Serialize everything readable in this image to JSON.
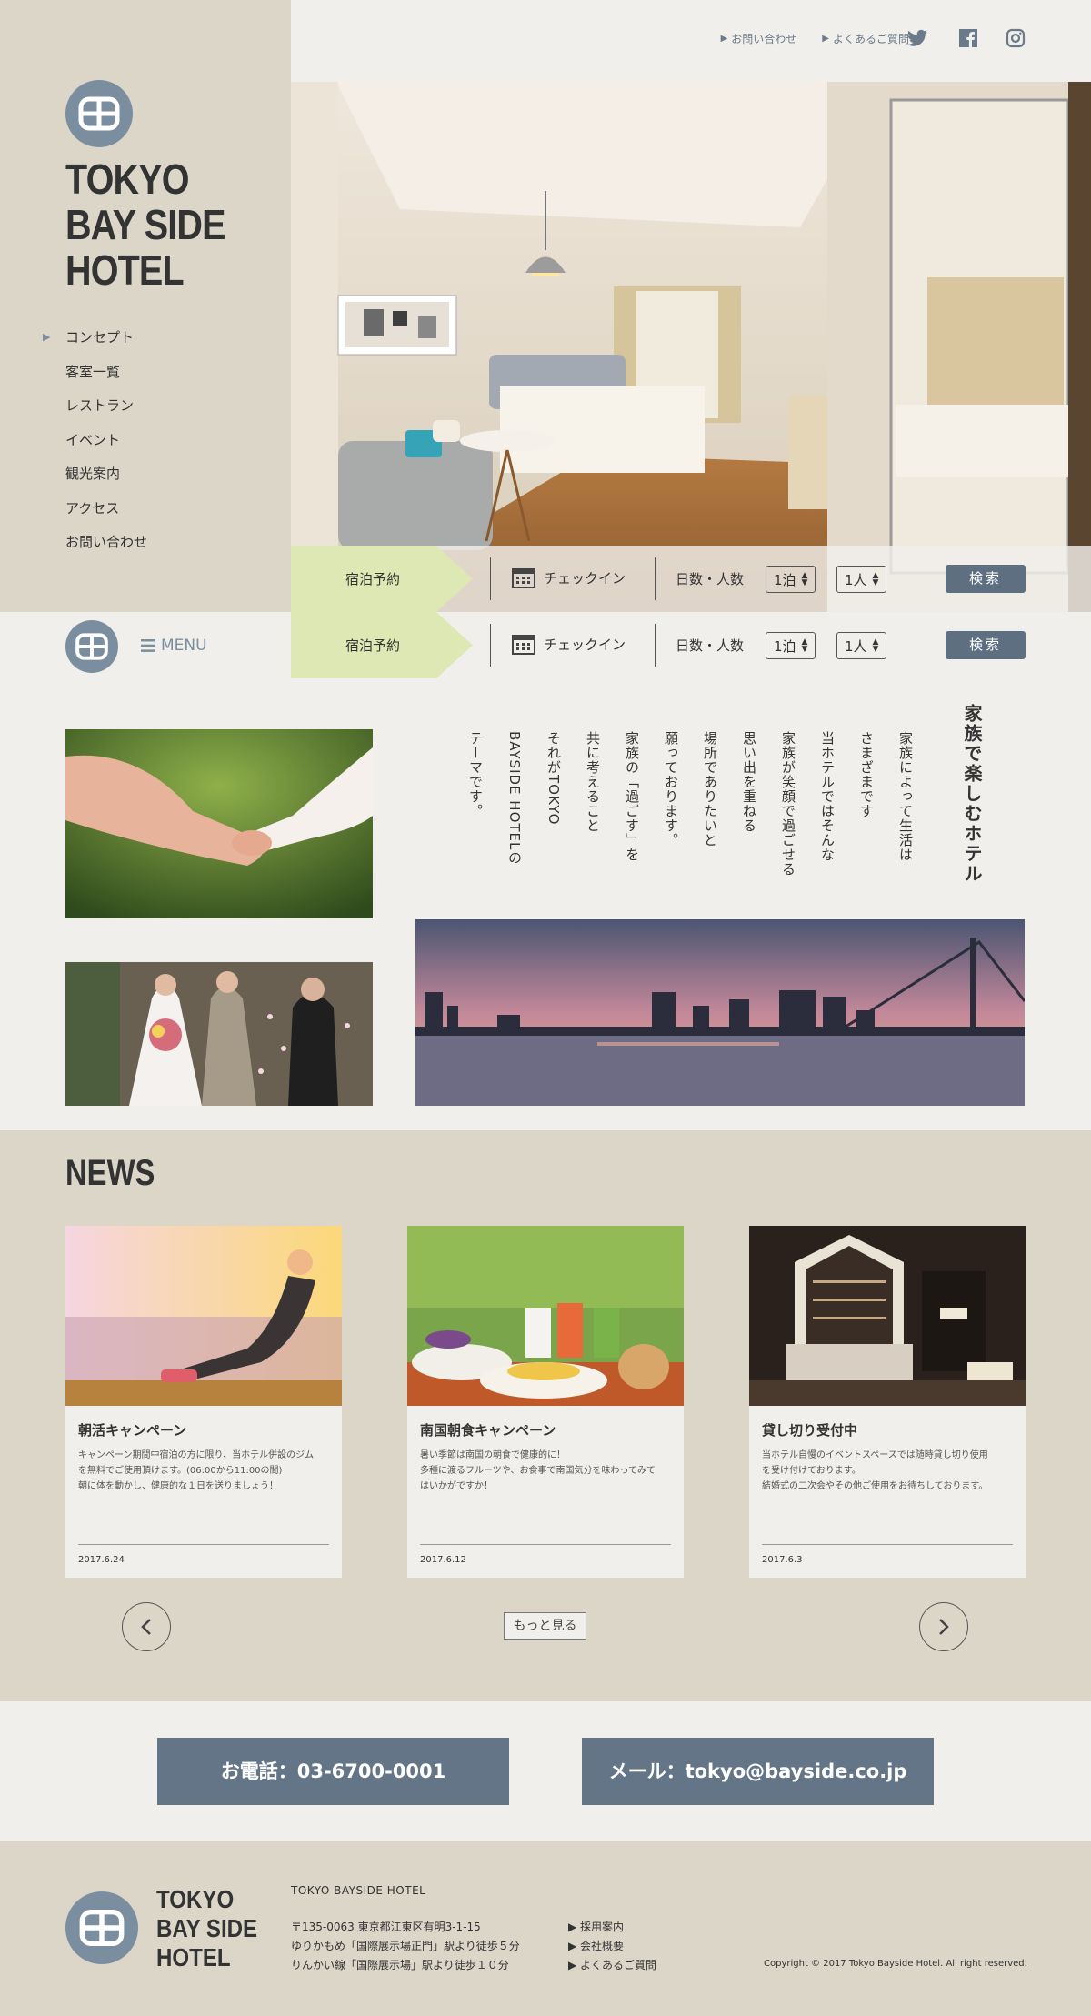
{
  "header": {
    "links": [
      {
        "label": "お問い合わせ"
      },
      {
        "label": "よくあるご質問"
      }
    ],
    "socials": [
      "twitter-icon",
      "facebook-icon",
      "instagram-icon"
    ]
  },
  "sidebar": {
    "brand_lines": [
      "TOKYO",
      "BAY SIDE",
      "HOTEL"
    ],
    "nav": [
      {
        "label": "コンセプト",
        "active": true
      },
      {
        "label": "客室一覧"
      },
      {
        "label": "レストラン"
      },
      {
        "label": "イベント"
      },
      {
        "label": "観光案内"
      },
      {
        "label": "アクセス"
      },
      {
        "label": "お問い合わせ"
      }
    ]
  },
  "reservation": {
    "label": "宿泊予約",
    "checkin": "チェックイン",
    "people_label": "日数・人数",
    "nights": "1泊",
    "guests": "1人",
    "search": "検索"
  },
  "menu": {
    "label": "MENU"
  },
  "concept": {
    "title": "家族で楽しむホテル",
    "lines": [
      "家族によって生活は",
      "さまざまです",
      "当ホテルではそんな",
      "家族が笑顔で過ごせる",
      "思い出を重ねる",
      "場所でありたいと",
      "願っております。",
      "家族の「過ごす」を",
      "共に考えること",
      "それがTOKYO",
      "BAYSIDE HOTELの",
      "テーマです。"
    ]
  },
  "news": {
    "title": "NEWS",
    "items": [
      {
        "title": "朝活キャンペーン",
        "body": [
          "キャンペーン期間中宿泊の方に限り、当ホテル併設のジム",
          "を無料でご使用頂けます。(06:00から11:00の間)",
          "朝に体を動かし、健康的な１日を送りましょう！"
        ],
        "date": "2017.6.24"
      },
      {
        "title": "南国朝食キャンペーン",
        "body": [
          "暑い季節は南国の朝食で健康的に！",
          "多種に渡るフルーツや、お食事で南国気分を味わってみて",
          "はいかがですか！"
        ],
        "date": "2017.6.12"
      },
      {
        "title": "貸し切り受付中",
        "body": [
          "当ホテル自慢のイベントスペースでは随時貸し切り使用",
          "を受け付けております。",
          "結婚式の二次会やその他ご使用をお待ちしております。"
        ],
        "date": "2017.6.3"
      }
    ],
    "more": "もっと見る"
  },
  "contact": {
    "phone": "お電話：03-6700-0001",
    "mail": "メール：tokyo@bayside.co.jp"
  },
  "footer": {
    "brand_lines": [
      "TOKYO",
      "BAY SIDE",
      "HOTEL"
    ],
    "name": "TOKYO BAYSIDE HOTEL",
    "address": [
      "〒135-0063 東京都江東区有明3-1-15",
      "ゆりかもめ「国際展示場正門」駅より徒歩５分",
      "りんかい線「国際展示場」駅より徒歩１０分"
    ],
    "links": [
      "採用案内",
      "会社概要",
      "よくあるご質問"
    ],
    "copyright": "Copyright © 2017 Tokyo Bayside Hotel. All right reserved."
  },
  "colors": {
    "accent": "#7b8ea0",
    "button": "#5d6f80",
    "sand": "#dcd6c9",
    "cream": "#f1efeb",
    "lime": "#dee8b4"
  }
}
